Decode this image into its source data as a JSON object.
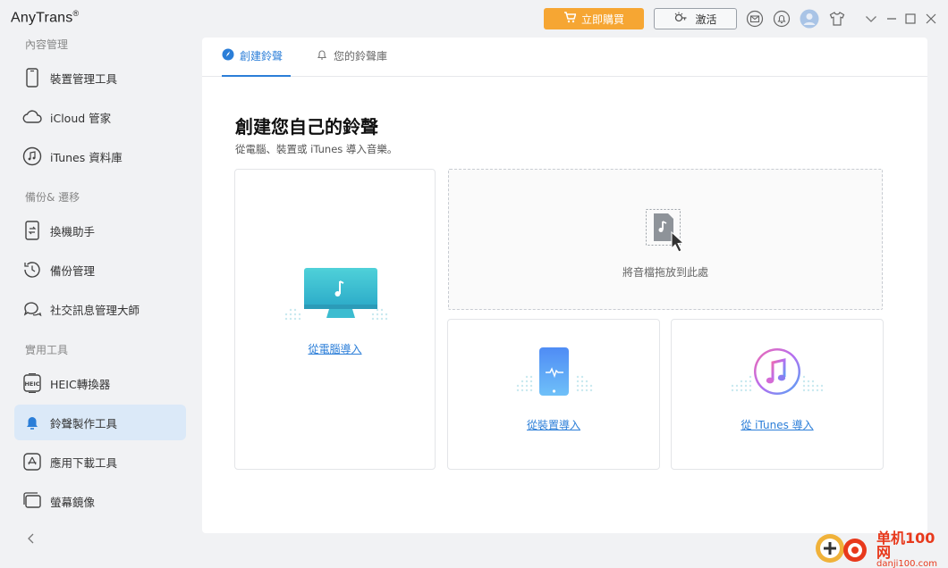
{
  "app": {
    "title": "AnyTrans",
    "reg_mark": "®"
  },
  "titlebar": {
    "buy_label": "立即購買",
    "activate_label": "激活",
    "icons": [
      "cart-icon",
      "key-icon",
      "mail-icon",
      "bell-icon",
      "avatar",
      "shirt-icon",
      "chevron-down-icon",
      "minimize-icon",
      "maximize-icon",
      "close-icon"
    ]
  },
  "sidebar": {
    "sections": [
      {
        "label": "內容管理"
      },
      {
        "label": "備份& 遷移"
      },
      {
        "label": "實用工具"
      }
    ],
    "items": [
      {
        "label": "裝置管理工具",
        "icon": "phone-icon"
      },
      {
        "label": "iCloud 管家",
        "icon": "cloud-icon"
      },
      {
        "label": "iTunes 資料庫",
        "icon": "music-note-icon"
      },
      {
        "label": "換機助手",
        "icon": "transfer-icon"
      },
      {
        "label": "備份管理",
        "icon": "history-icon"
      },
      {
        "label": "社交訊息管理大師",
        "icon": "chat-icon"
      },
      {
        "label": "HEIC轉換器",
        "icon": "heic-icon"
      },
      {
        "label": "鈴聲製作工具",
        "icon": "bell-icon",
        "active": true
      },
      {
        "label": "應用下載工具",
        "icon": "app-store-icon"
      },
      {
        "label": "螢幕鏡像",
        "icon": "mirror-icon"
      }
    ],
    "collapse_icon": "chevron-left-icon"
  },
  "main": {
    "tabs": [
      {
        "label": "創建鈴聲",
        "active": true
      },
      {
        "label": "您的鈴聲庫",
        "active": false
      }
    ],
    "heading": "創建您自己的鈴聲",
    "subheading": "從電腦、裝置或 iTunes 導入音樂。",
    "drop_zone_text": "將音檔拖放到此處",
    "import_pc": "從電腦導入",
    "import_device": "從裝置導入",
    "import_itunes": "從 iTunes 導入"
  },
  "watermark": {
    "title": "单机100网",
    "url": "danji100.com"
  },
  "colors": {
    "accent": "#2b7ed8",
    "buy": "#f6a633",
    "active_nav": "#dbe9f8"
  }
}
